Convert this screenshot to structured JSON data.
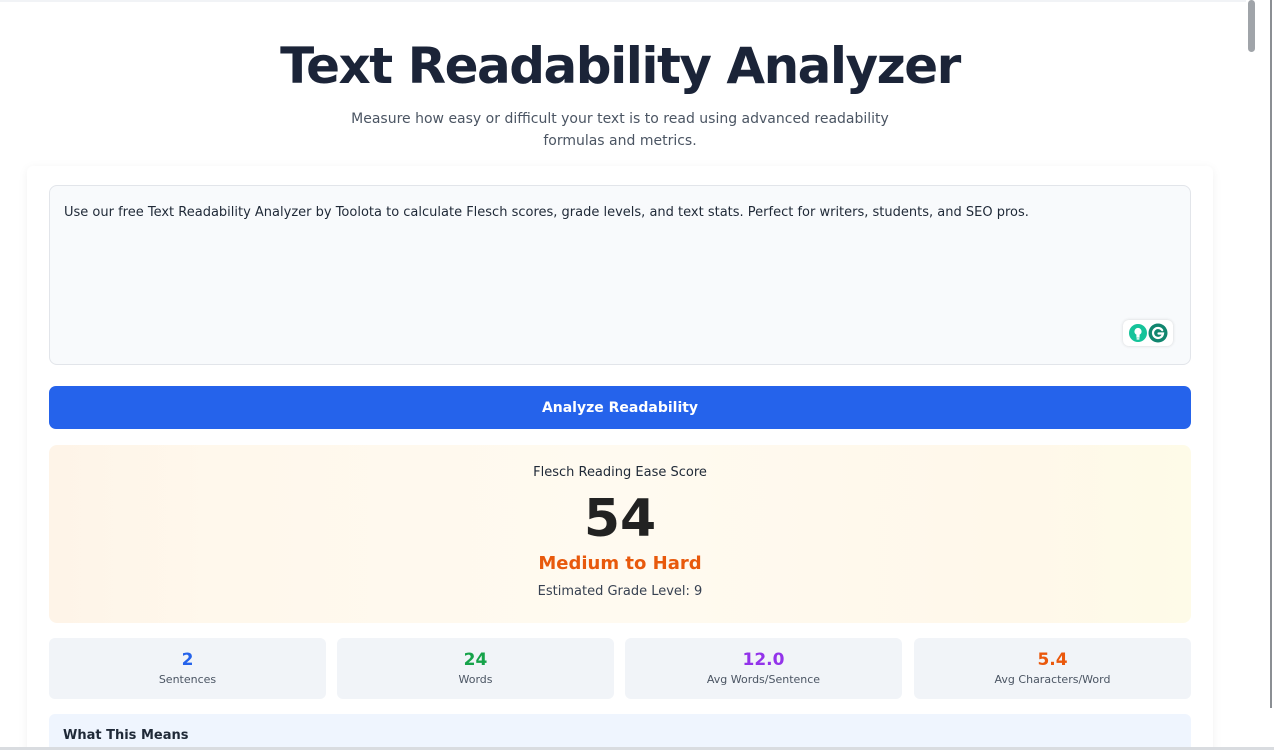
{
  "header": {
    "title": "Text Readability Analyzer",
    "subtitle": "Measure how easy or difficult your text is to read using advanced readability formulas and metrics."
  },
  "input": {
    "text": "Use our free Text Readability Analyzer by Toolota to calculate Flesch scores, grade levels, and text stats. Perfect for writers, students, and SEO pros."
  },
  "actions": {
    "analyze_label": "Analyze Readability"
  },
  "score": {
    "label": "Flesch Reading Ease Score",
    "value": "54",
    "level": "Medium to Hard",
    "grade_text": "Estimated Grade Level: 9"
  },
  "stats": [
    {
      "value": "2",
      "label": "Sentences",
      "color": "#2563eb"
    },
    {
      "value": "24",
      "label": "Words",
      "color": "#16a34a"
    },
    {
      "value": "12.0",
      "label": "Avg Words/Sentence",
      "color": "#9333ea"
    },
    {
      "value": "5.4",
      "label": "Avg Characters/Word",
      "color": "#ea580c"
    }
  ],
  "meaning": {
    "title": "What This Means"
  },
  "colors": {
    "primary": "#2563eb",
    "level": "#e8590c",
    "grammarly": "#15c39a"
  },
  "icons": {
    "assistant": "lightbulb-icon",
    "grammarly": "grammarly-g-icon"
  }
}
